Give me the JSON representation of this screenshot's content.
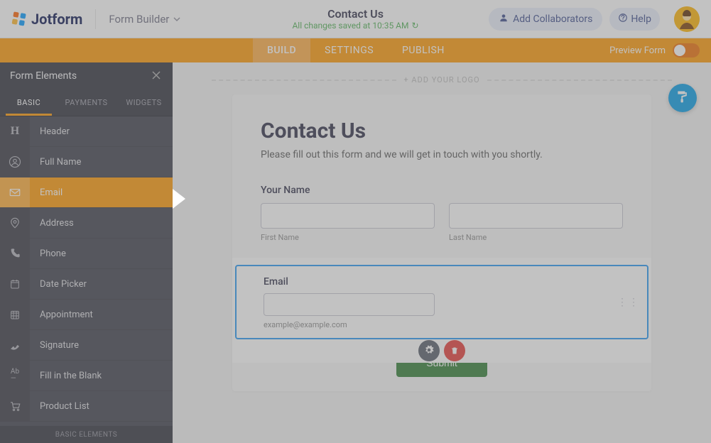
{
  "brand": "Jotform",
  "top": {
    "dropdown": "Form Builder",
    "title": "Contact Us",
    "saved": "All changes saved at 10:35 AM",
    "add_collab": "Add Collaborators",
    "help": "Help"
  },
  "main_tabs": [
    "BUILD",
    "SETTINGS",
    "PUBLISH"
  ],
  "preview_label": "Preview Form",
  "sidebar": {
    "title": "Form Elements",
    "tabs": [
      "BASIC",
      "PAYMENTS",
      "WIDGETS"
    ],
    "items": [
      {
        "label": "Header"
      },
      {
        "label": "Full Name"
      },
      {
        "label": "Email"
      },
      {
        "label": "Address"
      },
      {
        "label": "Phone"
      },
      {
        "label": "Date Picker"
      },
      {
        "label": "Appointment"
      },
      {
        "label": "Signature"
      },
      {
        "label": "Fill in the Blank"
      },
      {
        "label": "Product List"
      }
    ],
    "footer": "BASIC ELEMENTS"
  },
  "form": {
    "add_logo": "+ ADD YOUR LOGO",
    "title": "Contact Us",
    "subtitle": "Please fill out this form and we will get in touch with you shortly.",
    "name_label": "Your Name",
    "first_name": "First Name",
    "last_name": "Last Name",
    "email_label": "Email",
    "email_hint": "example@example.com",
    "submit": "Submit"
  }
}
